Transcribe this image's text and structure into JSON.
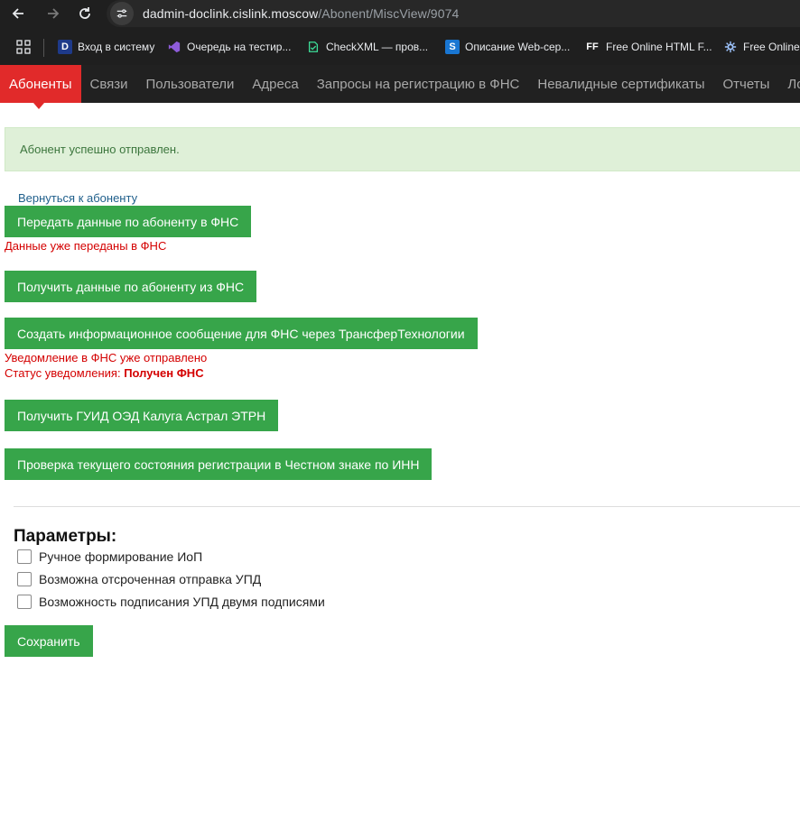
{
  "browser": {
    "url_host": "dadmin-doclink.cislink.moscow",
    "url_path": "/Abonent/MiscView/9074",
    "bookmarks": [
      {
        "label": "Вход в систему",
        "icon": "D"
      },
      {
        "label": "Очередь на тестир...",
        "icon": "vs-logo-icon"
      },
      {
        "label": "CheckXML — пров...",
        "icon": "checkxml-icon"
      },
      {
        "label": "Описание Web-сер...",
        "icon": "S"
      },
      {
        "label": "Free Online HTML F...",
        "icon": "FF"
      },
      {
        "label": "Free Online",
        "icon": "gear-icon"
      }
    ]
  },
  "nav": {
    "items": [
      {
        "label": "Абоненты",
        "active": true
      },
      {
        "label": "Связи"
      },
      {
        "label": "Пользователи"
      },
      {
        "label": "Адреса"
      },
      {
        "label": "Запросы на регистрацию в ФНС"
      },
      {
        "label": "Невалидные сертификаты"
      },
      {
        "label": "Отчеты"
      },
      {
        "label": "Лог о"
      }
    ],
    "accent": "#e12a2a"
  },
  "alert": {
    "text": "Абонент успешно отправлен."
  },
  "back_link": "Вернуться к абоненту",
  "actions": {
    "send_fns": "Передать данные по абоненту в ФНС",
    "send_fns_note": "Данные уже переданы в ФНС",
    "get_fns": "Получить данные по абоненту из ФНС",
    "create_msg": "Создать информационное сообщение для ФНС через ТрансферТехнологии",
    "notice_sent": "Уведомление в ФНС уже отправлено",
    "notice_status_label": "Статус уведомления: ",
    "notice_status_value": "Получен ФНС",
    "get_guid": "Получить ГУИД ОЭД Калуга Астрал ЭТРН",
    "check_chz": "Проверка текущего состояния регистрации в Честном знаке по ИНН",
    "button_color": "#37a54a"
  },
  "params": {
    "title": "Параметры:",
    "options": [
      {
        "label": "Ручное формирование ИоП",
        "checked": false
      },
      {
        "label": "Возможна отсроченная отправка УПД",
        "checked": false
      },
      {
        "label": "Возможность подписания УПД двумя подписями",
        "checked": false
      }
    ],
    "save": "Сохранить"
  }
}
